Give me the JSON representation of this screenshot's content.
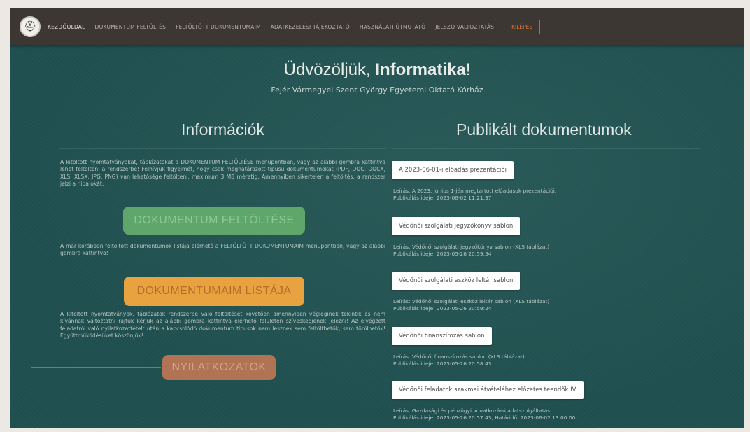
{
  "nav": {
    "home": "KEZDŐOLDAL",
    "items": [
      "DOKUMENTUM FELTÖLTÉS",
      "FELTÖLTÖTT DOKUMENTUMAIM",
      "ADATKEZELÉSI TÁJÉKOZTATÓ",
      "HASZNÁLATI ÚTMUTATÓ",
      "JELSZÓ VÁLTOZTATÁS"
    ],
    "logout": "KILÉPÉS"
  },
  "welcome": {
    "prefix": "Üdvözöljük, ",
    "name": "Informatika",
    "suffix": "!"
  },
  "subtitle": "Fejér Vármegyei Szent György Egyetemi Oktató Kórház",
  "info": {
    "title": "Információk",
    "para1": "A kitöltött nyomtatványokat, táblázatokat a DOKUMENTUM FELTÖLTÉSE menüpontban, vagy az alábbi gombra kattintva lehet feltölteni a rendszerbe! Felhívjuk figyelmét, hogy csak meghatározott típusú dokumentumokat (PDF, DOC, DOCX, XLS, XLSX, JPG, PNG) van lehetősége feltölteni, maximum 3 MB méretig. Amennyiben sikertelen a feltöltés, a rendszer jelzi a hiba okát.",
    "btn_upload": "DOKUMENTUM FELTÖLTÉSE",
    "para2": "A már korábban feltöltött dokumentumok listája elérhető a FELTÖLTÖTT DOKUMENTUMAIM menüpontban, vagy az alábbi gombra kattintva!",
    "btn_list": "DOKUMENTUMAIM LISTÁJA",
    "para3": "A kitöltött nyomtatványok, táblázatok rendszerbe való feltöltését követően amennyiben végleginek tekintik és nem kívánnak változtatni rajtuk kérjük az alábbi gombra kattintva elérhető felületen szíveskedjenek jelezni! Az elvégzett feladatról való nyilatkozattételt után a kapcsolódó dokumentum típusok nem lesznek sem feltölthetők, sem törölhetők! Együttműködésüket köszönjük!",
    "btn_decl": "NYILATKOZATOK"
  },
  "docs": {
    "title": "Publikált dokumentumok",
    "items": [
      {
        "title": "A 2023-06-01-i előadás prezentációi",
        "desc": "Leírás: A 2023. június 1-jén megtartott előadások prezentációi.",
        "date": "Publikálás ideje: 2023-06-02 11:21:37"
      },
      {
        "title": "Védőnői szolgálati jegyzőkönyv sablon",
        "desc": "Leírás: Védőnői szolgálati jegyzőkönyv sablon (XLS táblázat)",
        "date": "Publikálás ideje: 2023-05-26 20:59:54"
      },
      {
        "title": "Védőnői szolgálati eszköz leltár sablon",
        "desc": "Leírás: Védőnői szolgálati eszköz leltár sablon (XLS táblázat)",
        "date": "Publikálás ideje: 2023-05-26 20:59:24"
      },
      {
        "title": "Védőnői finanszírozás sablon",
        "desc": "Leírás: Védőnői finanszírozás sablon (XLS táblázat)",
        "date": "Publikálás ideje: 2023-05-26 20:58:43"
      },
      {
        "title": "Védőnői feladatok szakmai átvételéhez előzetes teendők IV.",
        "desc": "Leírás: Gazdasági és pénzügyi vonatkozású adatszolgáltatás",
        "date": "Publikálás ideje: 2023-05-26 20:57:43, Határidő: 2023-06-02 13:00:00"
      }
    ]
  }
}
